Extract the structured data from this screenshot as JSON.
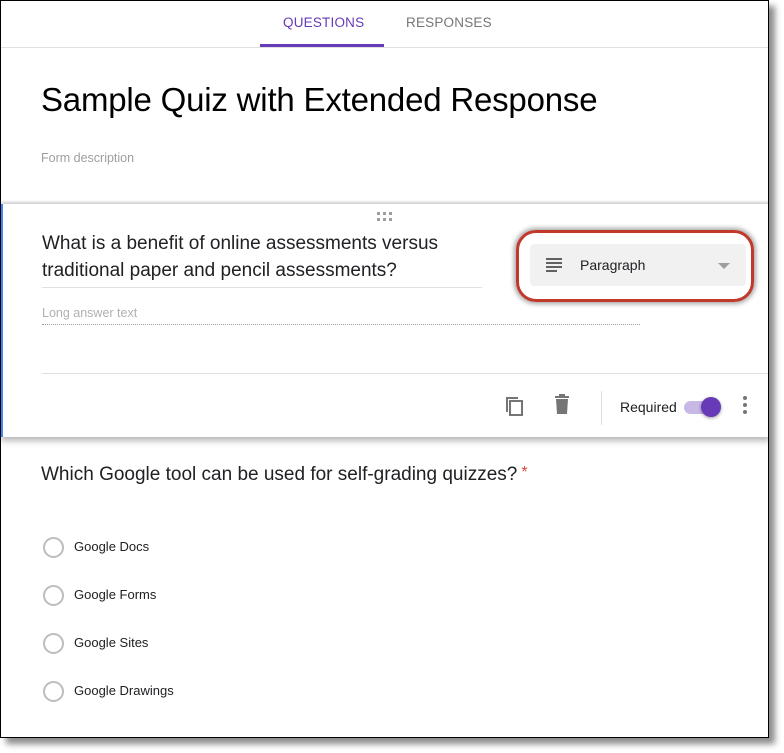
{
  "tabs": [
    {
      "label": "QUESTIONS",
      "active": true
    },
    {
      "label": "RESPONSES",
      "active": false
    }
  ],
  "form": {
    "title": "Sample Quiz with Extended Response",
    "description_placeholder": "Form description"
  },
  "question1": {
    "title": "What is a benefit of online assessments versus traditional paper and pencil assessments?",
    "type": {
      "icon": "paragraph-icon",
      "label": "Paragraph"
    },
    "answer_placeholder": "Long answer text",
    "actions": {
      "duplicate_icon": "copy-icon",
      "delete_icon": "trash-icon",
      "required_label": "Required",
      "required_on": true,
      "more_icon": "more-vert-icon"
    }
  },
  "question2": {
    "title": "Which Google tool can be used for self-grading quizzes?",
    "required_marker": "*",
    "options": [
      "Google Docs",
      "Google Forms",
      "Google Sites",
      "Google Drawings"
    ]
  },
  "colors": {
    "accent": "#673ab7",
    "active_card_border": "#4285f4",
    "highlight_ring": "#c0392b",
    "required_star": "#db4437"
  }
}
